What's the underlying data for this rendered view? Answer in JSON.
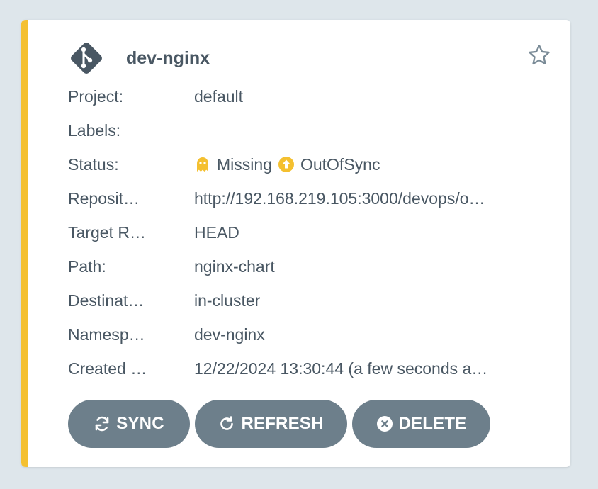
{
  "app": {
    "name": "dev-nginx"
  },
  "fields": {
    "project": {
      "label": "Project:",
      "value": "default"
    },
    "labels": {
      "label": "Labels:",
      "value": ""
    },
    "status": {
      "label": "Status:",
      "health": "Missing",
      "sync": "OutOfSync"
    },
    "repository": {
      "label": "Reposit…",
      "value": "http://192.168.219.105:3000/devops/o…"
    },
    "target_revision": {
      "label": "Target R…",
      "value": "HEAD"
    },
    "path": {
      "label": "Path:",
      "value": "nginx-chart"
    },
    "destination": {
      "label": "Destinat…",
      "value": "in-cluster"
    },
    "namespace": {
      "label": "Namesp…",
      "value": "dev-nginx"
    },
    "created_at": {
      "label": "Created …",
      "value": "12/22/2024 13:30:44  (a few seconds a…"
    }
  },
  "actions": {
    "sync": "SYNC",
    "refresh": "REFRESH",
    "delete": "DELETE"
  },
  "icons": {
    "app": "git-icon",
    "favorite": "star-icon",
    "health": "ghost-icon",
    "sync_status": "arrow-up-circle-icon",
    "sync_button": "sync-icon",
    "refresh_button": "refresh-icon",
    "delete_button": "times-circle-icon"
  },
  "colors": {
    "status_stripe": "#f4c030",
    "status_icon": "#f4c030",
    "button_bg": "#6d7f8b",
    "text": "#495763",
    "icon_dark": "#495763",
    "background": "#dee6eb"
  }
}
